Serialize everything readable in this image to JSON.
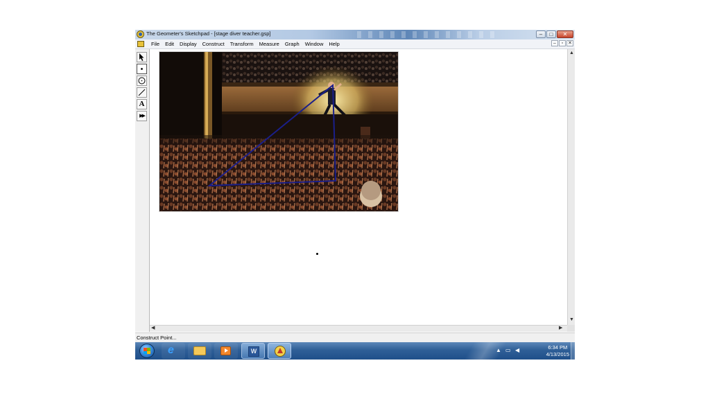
{
  "window": {
    "title": "The Geometer's Sketchpad - [stage diver teacher.gsp]",
    "buttons": {
      "minimize": "–",
      "maximize": "□",
      "close": "✕"
    }
  },
  "menu": {
    "items": [
      "File",
      "Edit",
      "Display",
      "Construct",
      "Transform",
      "Measure",
      "Graph",
      "Window",
      "Help"
    ],
    "doc_buttons": {
      "minimize": "–",
      "restore": "▫",
      "close": "✕"
    }
  },
  "toolbox": {
    "tools": [
      {
        "name": "selection-arrow-tool",
        "icon": "arrow-icon"
      },
      {
        "name": "point-tool",
        "icon": "point-icon"
      },
      {
        "name": "compass-tool",
        "icon": "circle-icon"
      },
      {
        "name": "straightedge-tool",
        "icon": "segment-icon"
      },
      {
        "name": "text-tool",
        "icon": "text-a-icon",
        "glyph": "A"
      },
      {
        "name": "custom-tool",
        "icon": "double-arrow-icon",
        "glyph": "▶▶"
      }
    ]
  },
  "status": {
    "text": "Construct Point..."
  },
  "taskbar": {
    "items": [
      "start-orb-icon",
      "internet-explorer-icon",
      "file-explorer-icon",
      "media-player-icon",
      "word-icon",
      "sketchpad-icon"
    ],
    "word_glyph": "W",
    "ie_glyph": "e",
    "clock_time": "6:34 PM",
    "clock_date": "4/13/2015"
  },
  "colors": {
    "triangle": "#1a1f8a",
    "taskbar": "#2f5f97"
  }
}
